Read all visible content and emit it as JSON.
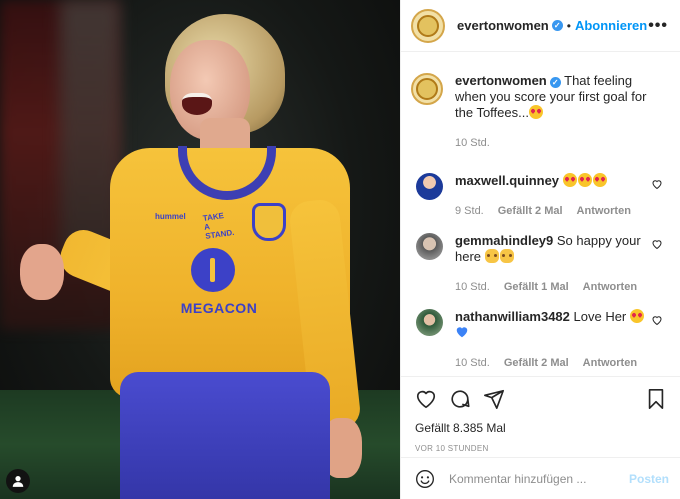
{
  "post": {
    "username": "evertonwomen",
    "follow_label": "Abonnieren",
    "more_label": "•••",
    "caption_text": "That feeling when you score your first goal for the Toffees...",
    "caption_age": "10 Std."
  },
  "photo": {
    "sponsor_text": "MEGACON",
    "brand_text": "hummel",
    "slogan_text": "TAKE A STAND."
  },
  "comments": [
    {
      "username": "maxwell.quinney",
      "text": "",
      "age": "9 Std.",
      "likes": "Gefällt 2 Mal",
      "reply": "Antworten",
      "avatar_color": "#1c3a9a"
    },
    {
      "username": "gemmahindley9",
      "text": "So happy your here",
      "age": "10 Std.",
      "likes": "Gefällt 1 Mal",
      "reply": "Antworten",
      "avatar_color": "#6e6e6e"
    },
    {
      "username": "nathanwilliam3482",
      "text": "Love Her",
      "age": "10 Std.",
      "likes": "Gefällt 2 Mal",
      "reply": "Antworten",
      "avatar_color": "#4b6b4b"
    }
  ],
  "footer": {
    "likes_text": "Gefällt 8.385 Mal",
    "time_text": "VOR 10 STUNDEN",
    "comment_placeholder": "Kommentar hinzufügen ...",
    "post_label": "Posten"
  },
  "colors": {
    "link_blue": "#0095f6",
    "post_disabled": "#b2dffc",
    "verified": "#3897f0",
    "jersey_yellow": "#f6c33b",
    "everton_blue": "#3c41c7"
  },
  "icons": [
    "user-tag-icon",
    "verified-icon",
    "more-icon",
    "heart-icon",
    "comment-icon",
    "share-icon",
    "save-icon",
    "emoji-icon"
  ]
}
